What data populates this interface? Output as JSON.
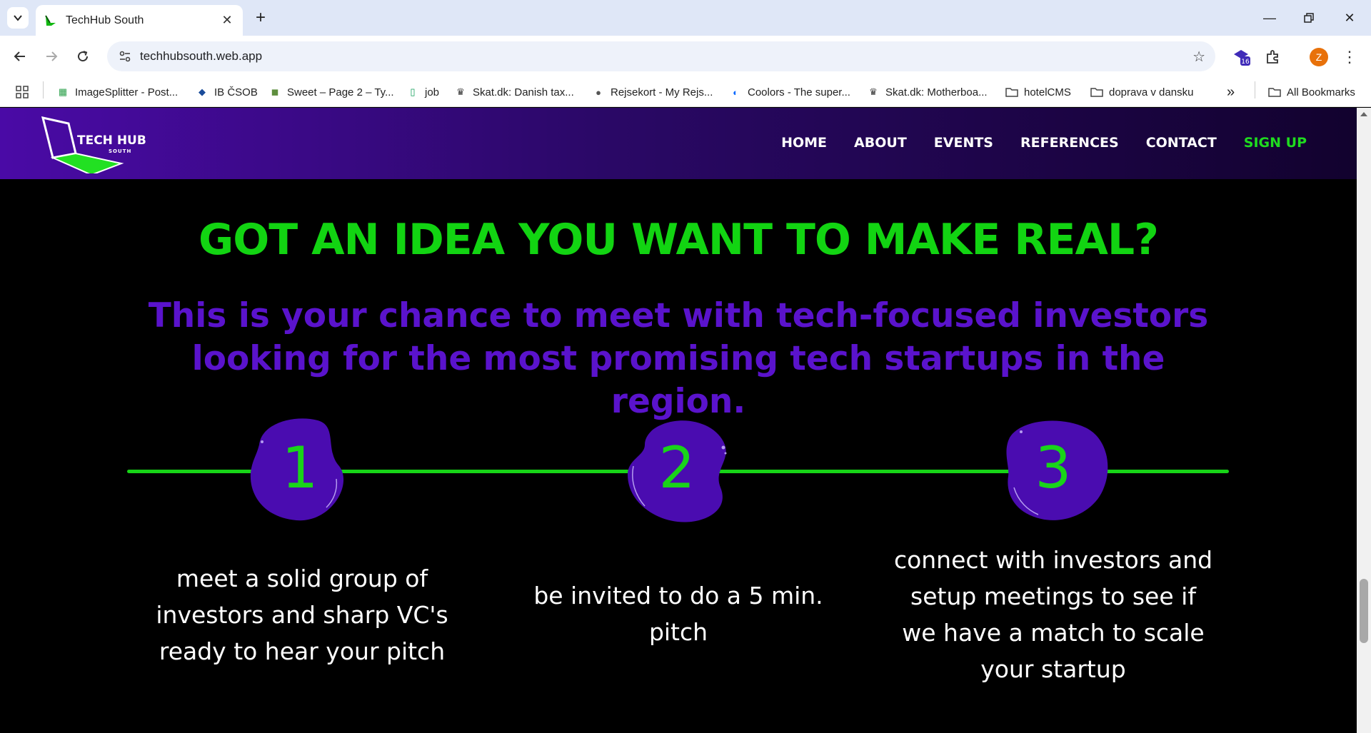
{
  "browser": {
    "tab_title": "TechHub South",
    "url": "techhubsouth.web.app",
    "extension_badge": "16",
    "profile_initial": "Z",
    "bookmarks": [
      {
        "label": "ImageSplitter - Post..."
      },
      {
        "label": "IB ČSOB"
      },
      {
        "label": "Sweet – Page 2 – Ty..."
      },
      {
        "label": "job"
      },
      {
        "label": "Skat.dk: Danish tax..."
      },
      {
        "label": "Rejsekort - My Rejs..."
      },
      {
        "label": "Coolors - The super..."
      },
      {
        "label": "Skat.dk: Motherboa..."
      },
      {
        "label": "hotelCMS"
      },
      {
        "label": "doprava v dansku"
      }
    ],
    "overflow_label": "»",
    "all_bookmarks": "All Bookmarks"
  },
  "site": {
    "logo_text": "TECH HUB",
    "logo_subtext": "SOUTH",
    "nav": [
      "HOME",
      "ABOUT",
      "EVENTS",
      "REFERENCES",
      "CONTACT",
      "SIGN UP"
    ],
    "headline": "GOT AN IDEA YOU WANT TO MAKE REAL?",
    "subhead": "This is your chance to meet with tech-focused investors looking for the most promising tech startups in the region.",
    "steps": [
      {
        "number": "1",
        "text": "meet a solid group of investors and sharp VC's ready to hear your pitch"
      },
      {
        "number": "2",
        "text": "be invited to do a 5 min. pitch"
      },
      {
        "number": "3",
        "text": "connect with investors and setup meetings to see if we have a match to scale your startup"
      }
    ]
  },
  "colors": {
    "accent_green": "#12d412",
    "accent_purple": "#5a13cc",
    "blob_purple": "#4a0cb0"
  }
}
